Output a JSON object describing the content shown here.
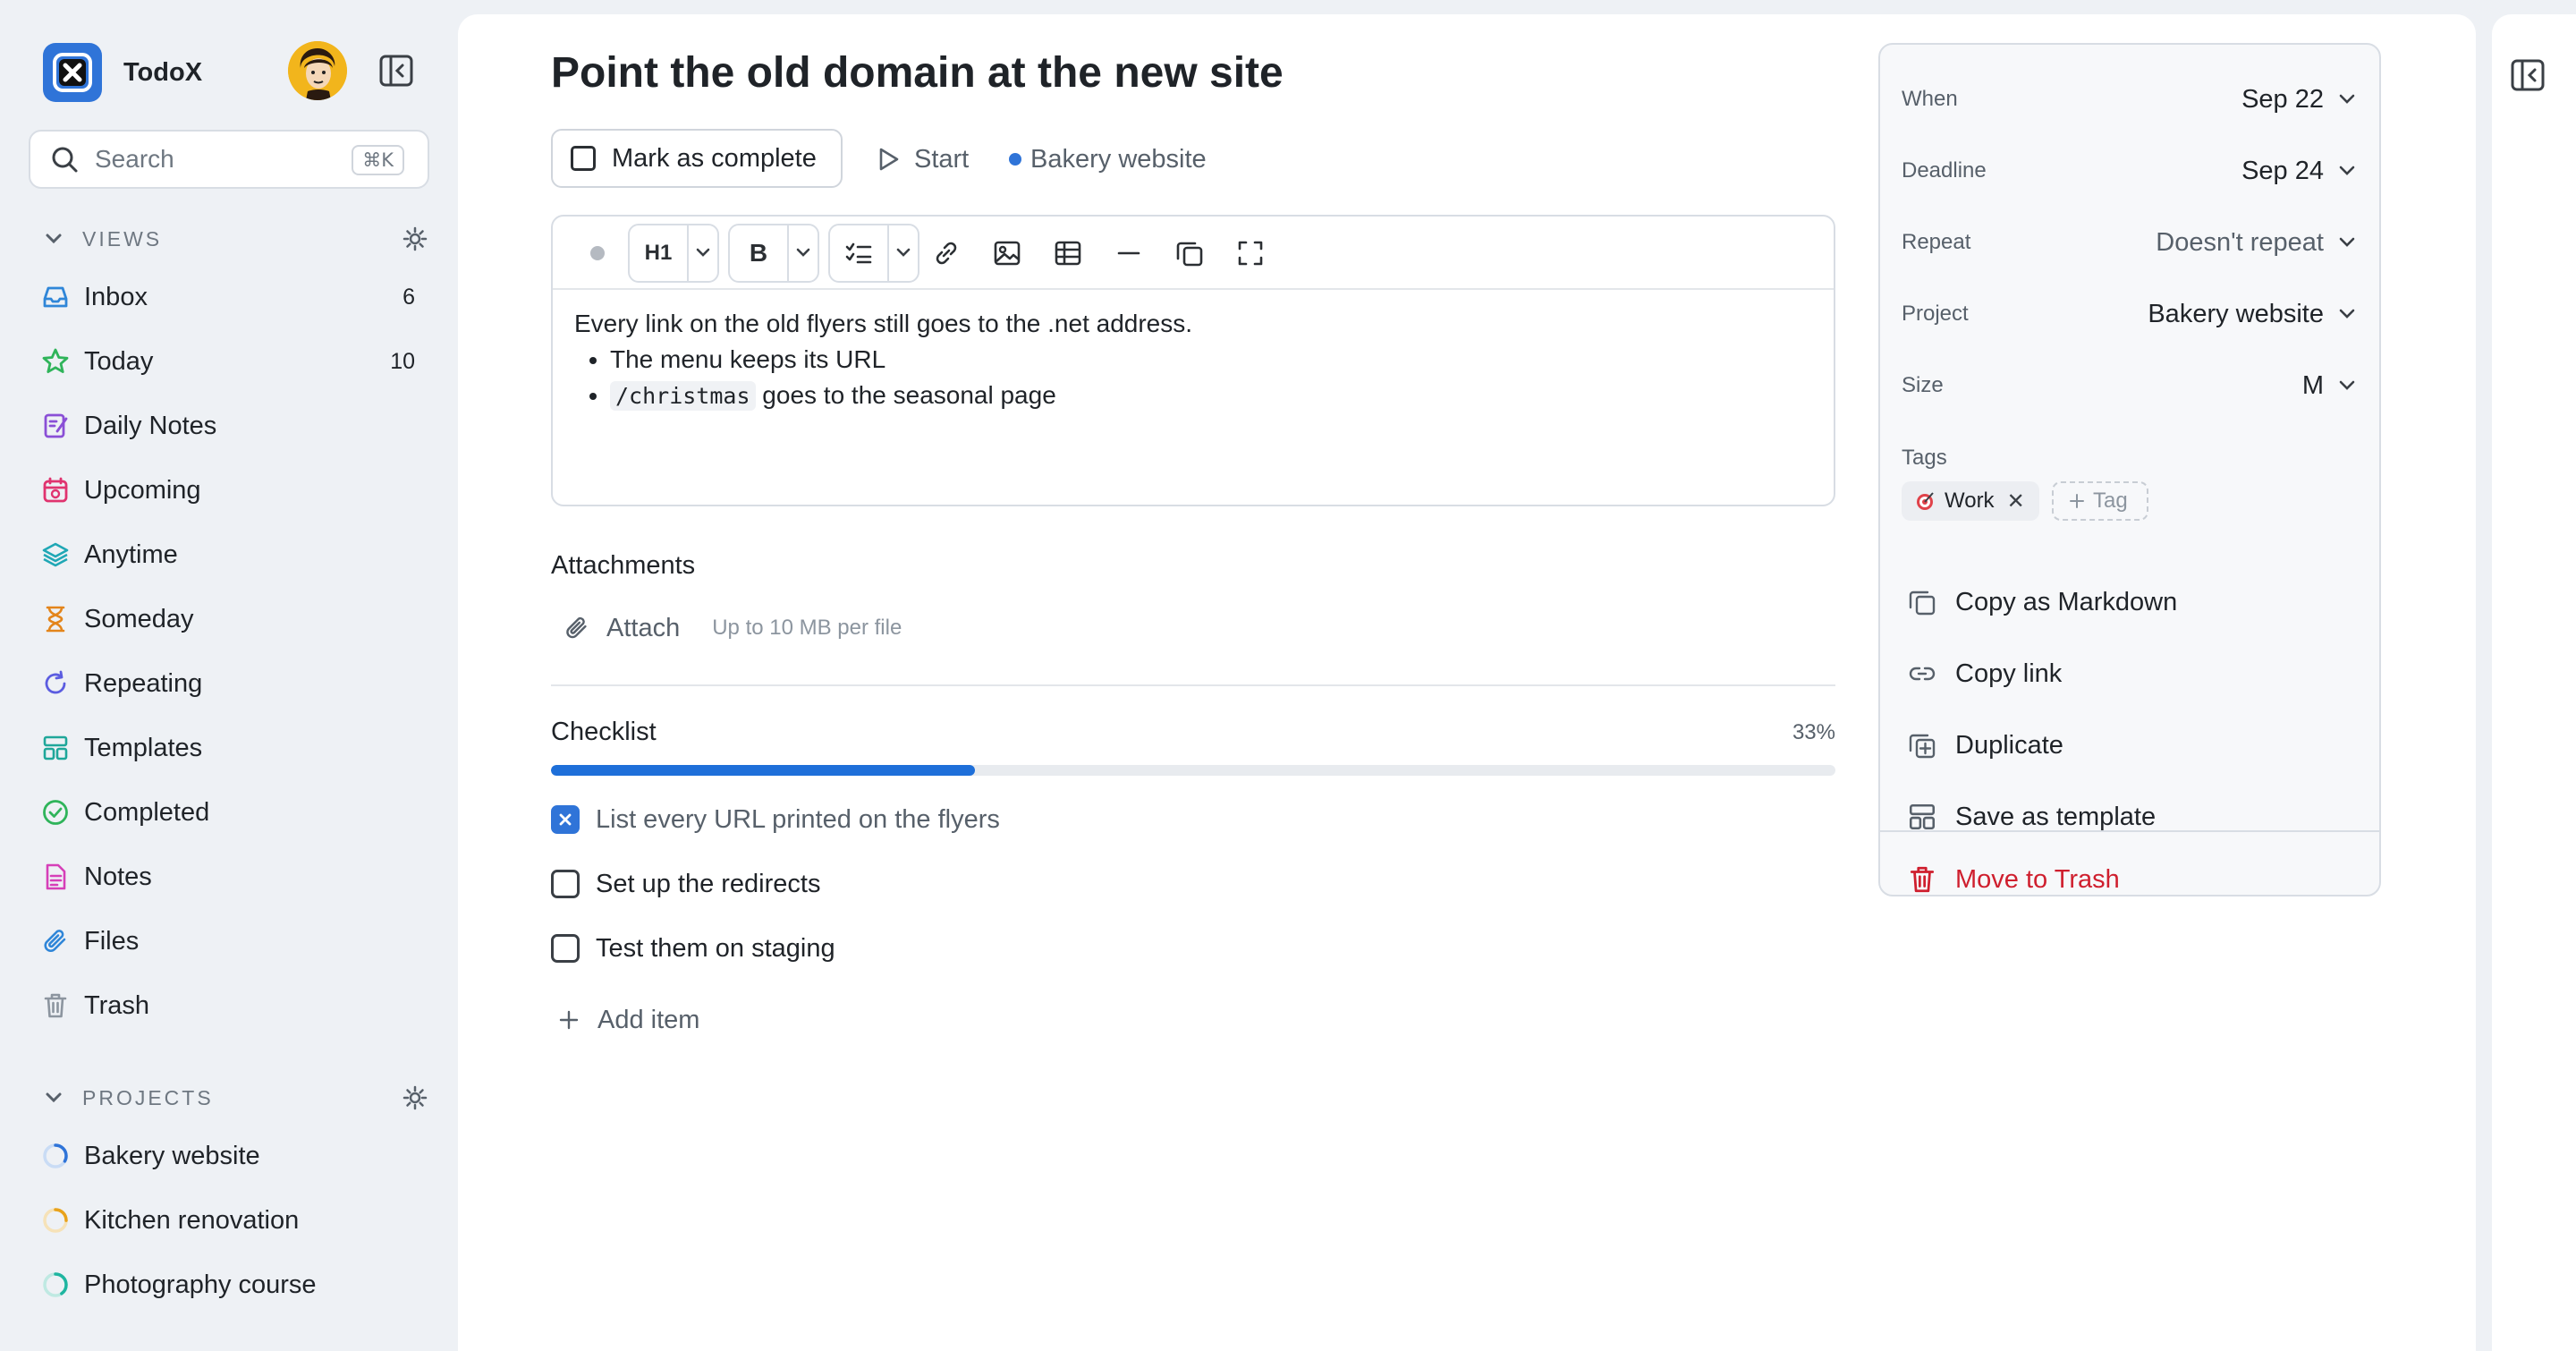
{
  "app": {
    "name": "TodoX"
  },
  "search": {
    "label": "Search",
    "shortcut": "⌘K"
  },
  "views": {
    "title": "VIEWS",
    "items": [
      {
        "label": "Inbox",
        "count": "6",
        "icon": "inbox-icon",
        "color": "#2f86d8"
      },
      {
        "label": "Today",
        "count": "10",
        "icon": "star-icon",
        "color": "#2fb45a"
      },
      {
        "label": "Daily Notes",
        "count": "",
        "icon": "daily-notes-icon",
        "color": "#8a4fd6"
      },
      {
        "label": "Upcoming",
        "count": "",
        "icon": "calendar-icon",
        "color": "#e0336f"
      },
      {
        "label": "Anytime",
        "count": "",
        "icon": "layers-icon",
        "color": "#1fa7b5"
      },
      {
        "label": "Someday",
        "count": "",
        "icon": "hourglass-icon",
        "color": "#e3851b"
      },
      {
        "label": "Repeating",
        "count": "",
        "icon": "repeat-icon",
        "color": "#5b5ce0"
      },
      {
        "label": "Templates",
        "count": "",
        "icon": "template-icon",
        "color": "#1fa79a"
      },
      {
        "label": "Completed",
        "count": "",
        "icon": "check-circle-icon",
        "color": "#2fb45a"
      },
      {
        "label": "Notes",
        "count": "",
        "icon": "note-icon",
        "color": "#d63fb8"
      },
      {
        "label": "Files",
        "count": "",
        "icon": "paperclip-icon",
        "color": "#2f86d8"
      },
      {
        "label": "Trash",
        "count": "",
        "icon": "trash-icon",
        "color": "#8c959f"
      }
    ]
  },
  "projects": {
    "title": "PROJECTS",
    "items": [
      {
        "label": "Bakery website",
        "color": "#2f74d8",
        "progress": 0.33
      },
      {
        "label": "Kitchen renovation",
        "color": "#e8a21b",
        "progress": 0.25
      },
      {
        "label": "Photography course",
        "color": "#1fb5a0",
        "progress": 0.4
      }
    ]
  },
  "task": {
    "title": "Point the old domain at the new site",
    "mark_complete": "Mark as complete",
    "start": "Start",
    "project": "Bakery website",
    "project_color": "#2f74d8"
  },
  "editor": {
    "toolbar": {
      "heading": "H1",
      "bold": "B"
    },
    "paragraph": "Every link on the old flyers still goes to the .net address.",
    "bullet1": "The menu keeps its URL",
    "bullet2_code": "/christmas",
    "bullet2_text": " goes to the seasonal page"
  },
  "attachments": {
    "title": "Attachments",
    "attach": "Attach",
    "hint": "Up to 10 MB per file"
  },
  "checklist": {
    "title": "Checklist",
    "percent": "33%",
    "progress": 0.33,
    "items": [
      {
        "label": "List every URL printed on the flyers",
        "done": true
      },
      {
        "label": "Set up the redirects",
        "done": false
      },
      {
        "label": "Test them on staging",
        "done": false
      }
    ],
    "add_item": "Add item"
  },
  "properties": {
    "when": {
      "label": "When",
      "value": "Sep 22"
    },
    "deadline": {
      "label": "Deadline",
      "value": "Sep 24"
    },
    "repeat": {
      "label": "Repeat",
      "value": "Doesn't repeat"
    },
    "project": {
      "label": "Project",
      "value": "Bakery website"
    },
    "size": {
      "label": "Size",
      "value": "M"
    },
    "tags_label": "Tags",
    "tag": "Work",
    "add_tag": "Tag"
  },
  "actions": {
    "copy_markdown": "Copy as Markdown",
    "copy_link": "Copy link",
    "duplicate": "Duplicate",
    "save_template": "Save as template",
    "trash": "Move to Trash"
  }
}
